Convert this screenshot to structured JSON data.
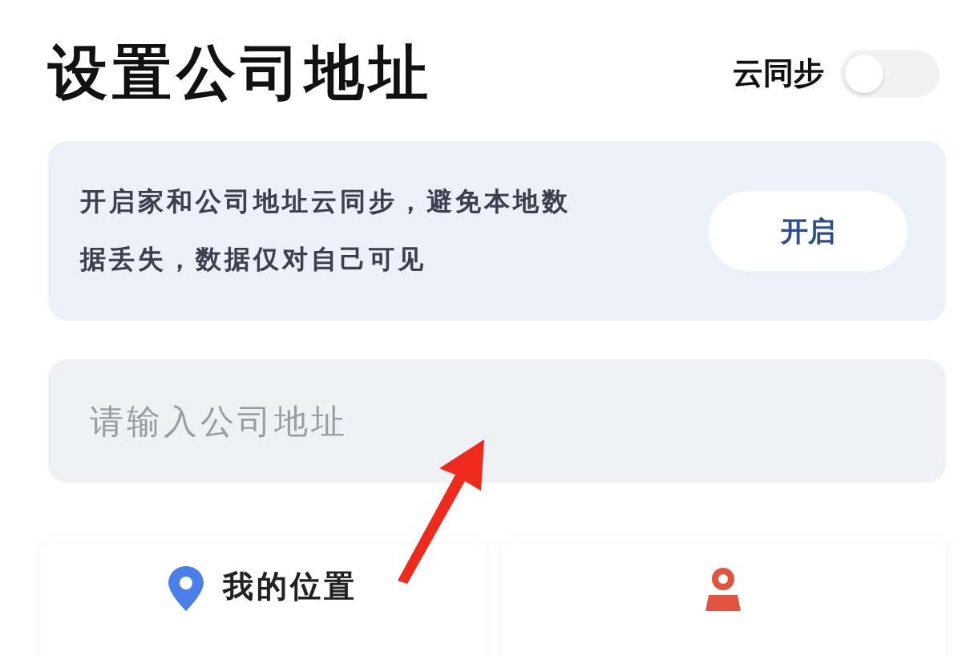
{
  "title": "设置公司地址",
  "cloud_sync": {
    "label": "云同步",
    "on": false
  },
  "banner": {
    "text": "开启家和公司地址云同步，避免本地数据丢失，数据仅对自己可见",
    "button": "开启"
  },
  "address_field": {
    "placeholder": "请输入公司地址"
  },
  "options": [
    {
      "kind": "my-location",
      "label": "我的位置"
    },
    {
      "kind": "map-pick"
    }
  ]
}
